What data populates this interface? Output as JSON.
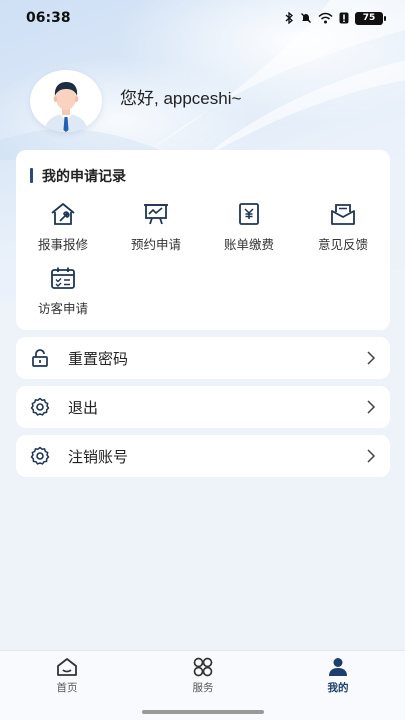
{
  "status_bar": {
    "time": "06:38",
    "battery": "75",
    "icons": [
      "bluetooth-icon",
      "mute-icon",
      "wifi-icon",
      "alert-icon",
      "battery-icon"
    ]
  },
  "profile": {
    "greeting": "您好, appceshi~"
  },
  "records": {
    "title": "我的申请记录",
    "items": [
      {
        "label": "报事报修",
        "icon": "house-wrench-icon"
      },
      {
        "label": "预约申请",
        "icon": "presentation-board-icon"
      },
      {
        "label": "账单缴费",
        "icon": "yen-bill-icon"
      },
      {
        "label": "意见反馈",
        "icon": "feedback-envelope-icon"
      },
      {
        "label": "访客申请",
        "icon": "calendar-check-icon"
      }
    ]
  },
  "menu": [
    {
      "label": "重置密码",
      "icon": "lock-icon"
    },
    {
      "label": "退出",
      "icon": "settings-gear-icon"
    },
    {
      "label": "注销账号",
      "icon": "settings-gear-icon"
    }
  ],
  "tabs": [
    {
      "label": "首页",
      "icon": "home-icon",
      "active": false
    },
    {
      "label": "服务",
      "icon": "grid-services-icon",
      "active": false
    },
    {
      "label": "我的",
      "icon": "user-icon",
      "active": true
    }
  ],
  "colors": {
    "accent": "#1e3f6e",
    "icon_stroke": "#1f3553",
    "background": "#eef3f9"
  }
}
